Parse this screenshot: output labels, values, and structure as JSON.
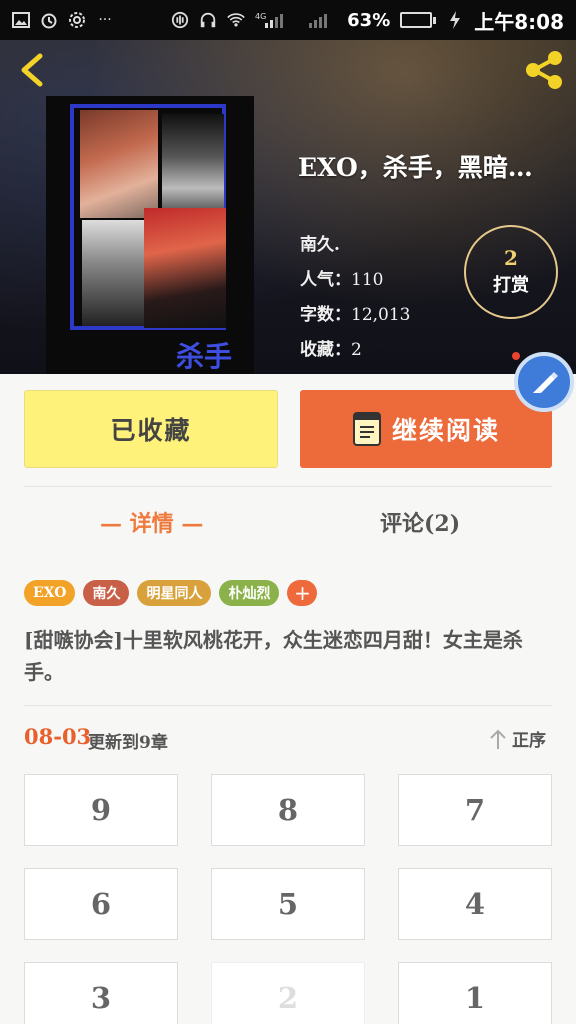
{
  "status_bar": {
    "battery_percent_text": "63%",
    "battery_level": 0.63,
    "time": "上午8:08",
    "network": "4G"
  },
  "book": {
    "title": "EXO，杀手，黑暗…",
    "author": "南久.",
    "popularity_label": "人气：",
    "popularity": "110",
    "words_label": "字数：",
    "words": "12,013",
    "favorites_label": "收藏：",
    "favorites": "2",
    "cover_text": "杀手"
  },
  "tip": {
    "count": "2",
    "label": "打赏"
  },
  "actions": {
    "collected_label": "已收藏",
    "continue_label": "继续阅读"
  },
  "tabs": {
    "detail": "— 详情 —",
    "comments": "评论(2)"
  },
  "tags": [
    {
      "label": "EXO",
      "color": "#f2a227"
    },
    {
      "label": "南久",
      "color": "#c85f47"
    },
    {
      "label": "明星同人",
      "color": "#d9a13b"
    },
    {
      "label": "朴灿烈",
      "color": "#8bb24a"
    }
  ],
  "tag_add": "+",
  "description": "[甜嗾协会]十里软风桃花开，众生迷恋四月甜！女主是杀手。",
  "update": {
    "date": "08-03",
    "text": "更新到9章",
    "sort_label": "正序"
  },
  "chapters": [
    "9",
    "8",
    "7",
    "6",
    "5",
    "4",
    "3",
    "2",
    "1"
  ],
  "colors": {
    "accent": "#ed6a3b",
    "collect_bg": "#fff27a",
    "tab_active": "#ef7a3e"
  }
}
